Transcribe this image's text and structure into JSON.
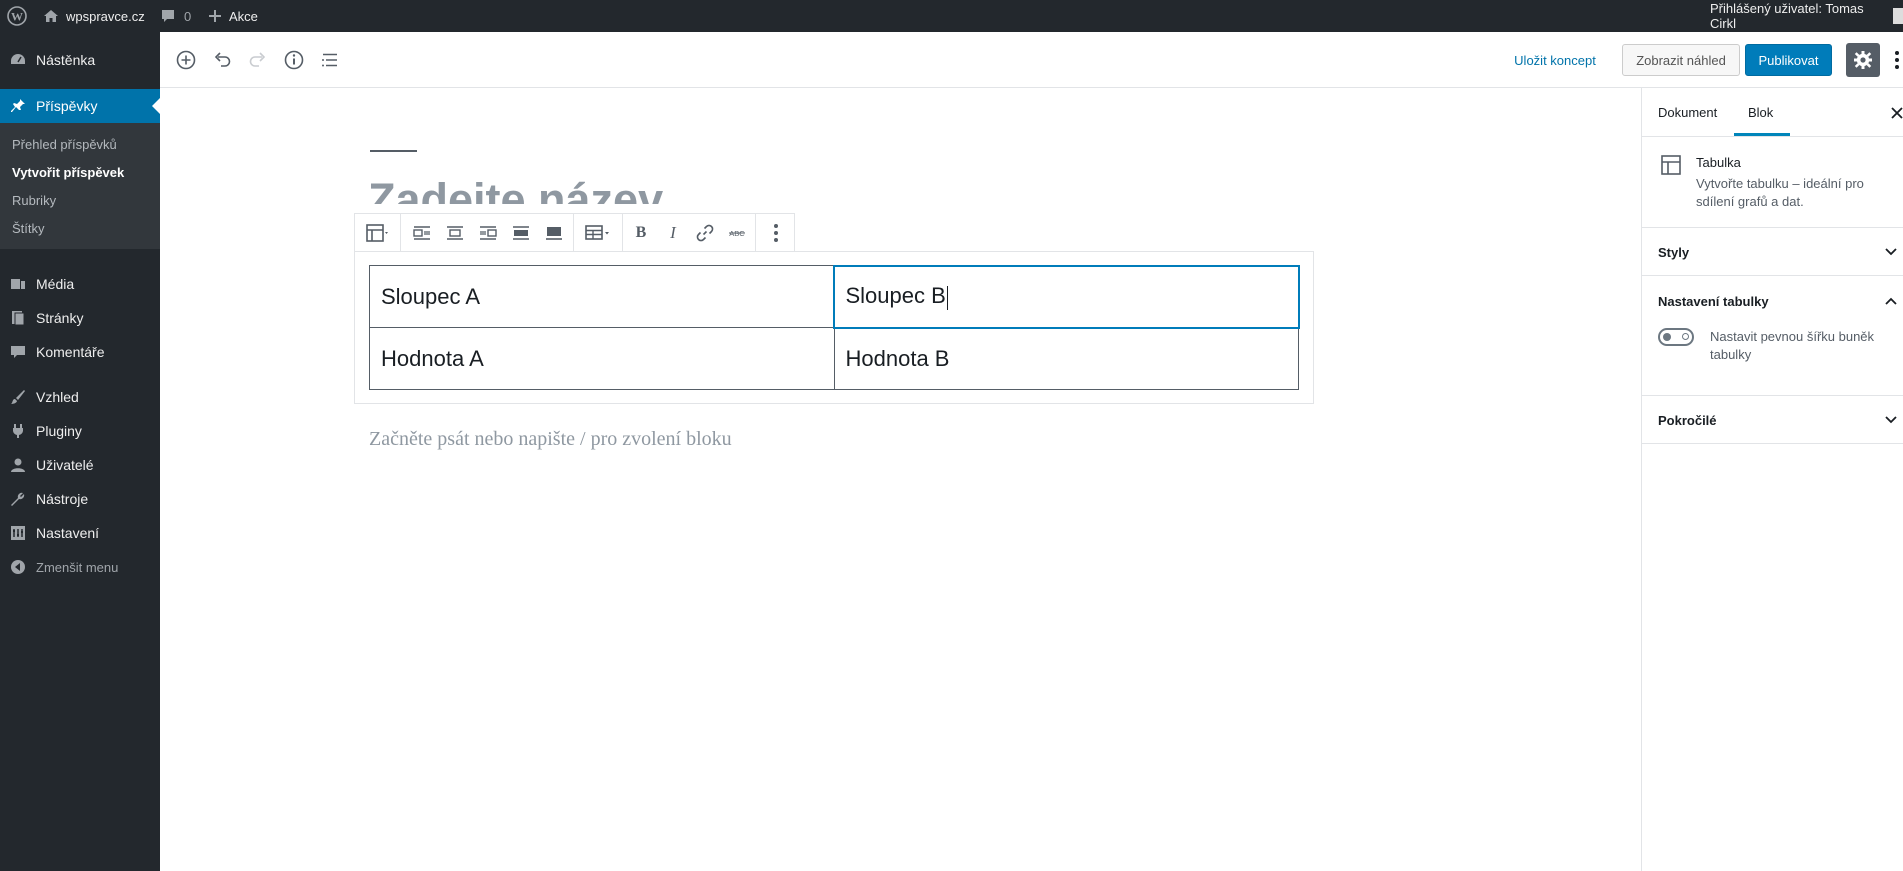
{
  "adminbar": {
    "site_name": "wpspravce.cz",
    "comments_count": "0",
    "new_label": "Akce",
    "greeting": "Přihlášený uživatel: Tomas Cirkl"
  },
  "menu": {
    "dashboard": "Nástěnka",
    "posts": "Příspěvky",
    "posts_sub": [
      "Přehled příspěvků",
      "Vytvořit příspěvek",
      "Rubriky",
      "Štítky"
    ],
    "media": "Média",
    "pages": "Stránky",
    "comments": "Komentáře",
    "appearance": "Vzhled",
    "plugins": "Pluginy",
    "users": "Uživatelé",
    "tools": "Nástroje",
    "settings": "Nastavení",
    "collapse": "Zmenšit menu"
  },
  "header": {
    "save_draft": "Uložit koncept",
    "preview": "Zobrazit náhled",
    "publish": "Publikovat"
  },
  "editor": {
    "title_placeholder": "Zadejte název",
    "table": {
      "rows": [
        [
          "Sloupec A",
          "Sloupec B"
        ],
        [
          "Hodnota A",
          "Hodnota B"
        ]
      ]
    },
    "paragraph_placeholder": "Začněte psát nebo napište / pro zvolení bloku"
  },
  "sidebar": {
    "tabs": [
      "Dokument",
      "Blok"
    ],
    "active_tab": "Blok",
    "block_name": "Tabulka",
    "block_desc": "Vytvořte tabulku – ideální pro sdílení grafů a dat.",
    "panels": {
      "styles": "Styly",
      "table_settings": "Nastavení tabulky",
      "fixed_width_label": "Nastavit pevnou šířku buněk tabulky",
      "advanced": "Pokročilé"
    }
  },
  "colors": {
    "admin_dark": "#23282d",
    "accent": "#0073aa",
    "publish": "#007cba"
  }
}
